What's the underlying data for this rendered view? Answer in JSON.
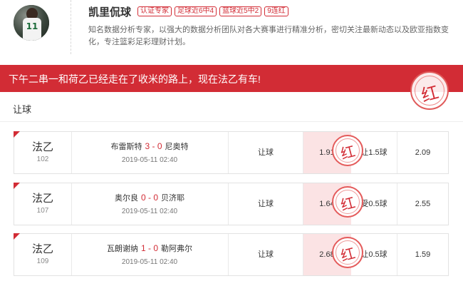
{
  "expert": {
    "name": "凯里侃球",
    "tags": [
      "认证专家",
      "足球近6中4",
      "篮球近5中2",
      "9连红"
    ],
    "description": "知名数据分析专家，以强大的数据分析团队对各大赛事进行精准分析，密切关注最新动态以及欧亚指数变化，专注篮彩足彩理财计划。",
    "avatar_jersey_number": "11"
  },
  "banner": {
    "text": "下午二串一和荷乙已经走在了收米的路上，现在法乙有车!",
    "stamp": "红"
  },
  "section": {
    "title": "让球"
  },
  "matches": [
    {
      "league": "法乙",
      "number": "102",
      "home": "布雷斯特",
      "score": "3 - 0",
      "away": "尼奥特",
      "time": "2019-05-11 02:40",
      "bet_type": "让球",
      "odds_home": "1.91",
      "handicap": "让1.5球",
      "odds_away": "2.09",
      "result_stamp": "红"
    },
    {
      "league": "法乙",
      "number": "107",
      "home": "奥尔良",
      "score": "0 - 0",
      "away": "贝济耶",
      "time": "2019-05-11 02:40",
      "bet_type": "让球",
      "odds_home": "1.64",
      "handicap": "受0.5球",
      "odds_away": "2.55",
      "result_stamp": "红"
    },
    {
      "league": "法乙",
      "number": "109",
      "home": "瓦朗谢纳",
      "score": "1 - 0",
      "away": "勒阿弗尔",
      "time": "2019-05-11 02:40",
      "bet_type": "让球",
      "odds_home": "2.68",
      "handicap": "让0.5球",
      "odds_away": "1.59",
      "result_stamp": "红"
    }
  ]
}
